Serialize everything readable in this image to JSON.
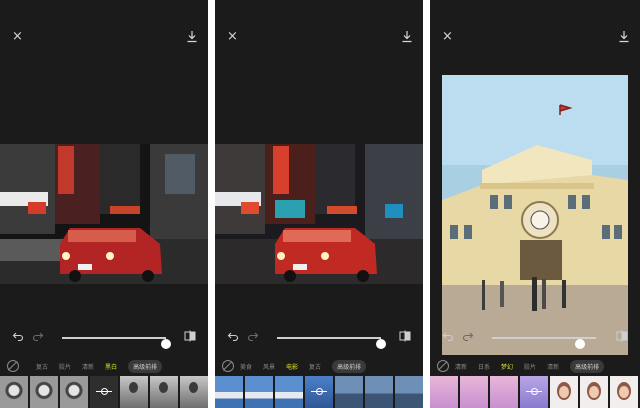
{
  "panels": [
    {
      "close_glyph": "×",
      "download_icon": "download-icon",
      "slider_value": 1.0,
      "categories": [
        "",
        "",
        "",
        "",
        "",
        "",
        "黑白",
        "高级前排"
      ],
      "category_labels": [
        {
          "label": "",
          "state": "normal"
        }
      ],
      "filters": [
        "无",
        "",
        "复古",
        "胶片",
        "清新",
        "黑白",
        "高级前排"
      ],
      "active_filter": "黑白",
      "active_pill": "高级前排"
    },
    {
      "close_glyph": "×",
      "slider_value": 1.0,
      "filters": [
        "无",
        "美食",
        "风景",
        "电影",
        "复古",
        "高级前排"
      ],
      "active_filter": "电影",
      "active_pill": "高级前排"
    },
    {
      "close_glyph": "×",
      "slider_value": 0.85,
      "filters": [
        "无",
        "清新",
        "日系",
        "梦幻",
        "胶片",
        "清新",
        "高级前排"
      ],
      "active_filter": "梦幻",
      "active_pill": "高级前排"
    }
  ],
  "colors": {
    "panel_bg": "#1b1b1b",
    "active_category": "#d7e02b",
    "slider": "#ffffff"
  }
}
